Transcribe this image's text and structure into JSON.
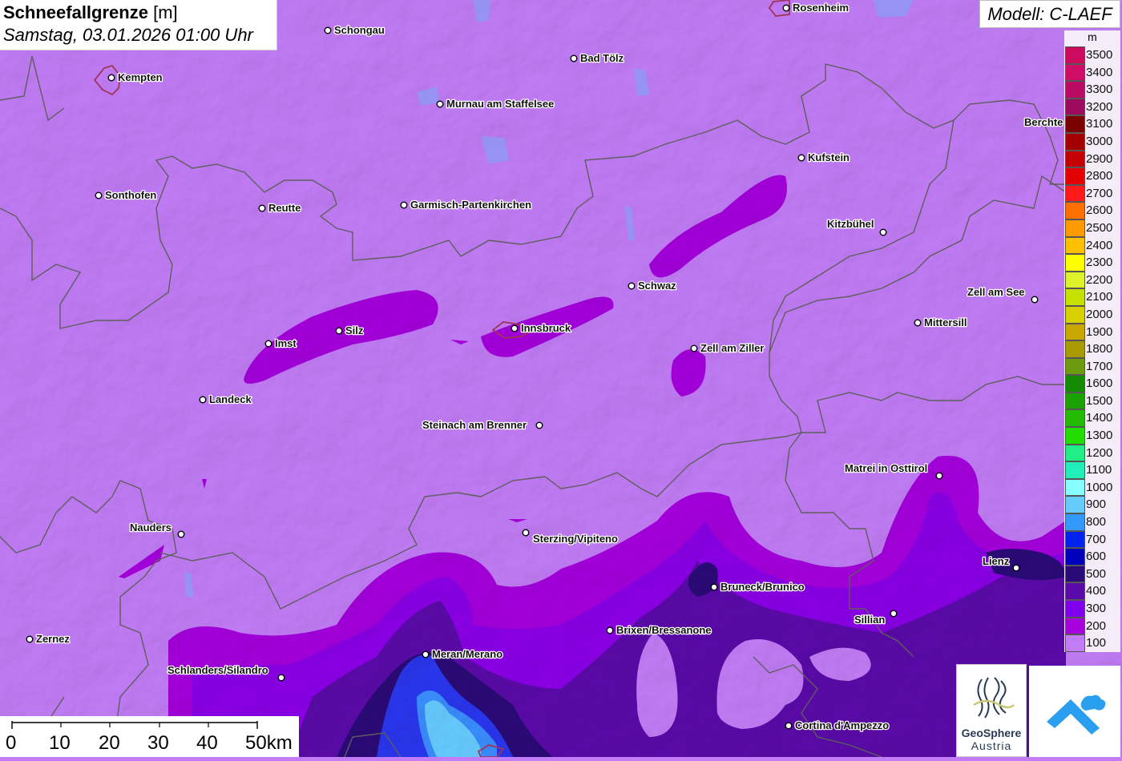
{
  "title": {
    "bold": "Schneefallgrenze",
    "unit": "[m]",
    "date": "Samstag, 03.01.2026 01:00 Uhr"
  },
  "model": "Modell: C-LAEF",
  "legend": {
    "unit": "m",
    "entries": [
      {
        "label": "3500",
        "color": "#cc0a5e"
      },
      {
        "label": "3400",
        "color": "#cf0d66"
      },
      {
        "label": "3300",
        "color": "#bb0a63"
      },
      {
        "label": "3200",
        "color": "#9b0a5c"
      },
      {
        "label": "3100",
        "color": "#7a0000"
      },
      {
        "label": "3000",
        "color": "#a50000"
      },
      {
        "label": "2900",
        "color": "#c50000"
      },
      {
        "label": "2800",
        "color": "#e30000"
      },
      {
        "label": "2700",
        "color": "#ff1a1a"
      },
      {
        "label": "2600",
        "color": "#ff6e00"
      },
      {
        "label": "2500",
        "color": "#ff9a00"
      },
      {
        "label": "2400",
        "color": "#ffc000"
      },
      {
        "label": "2300",
        "color": "#ffff00"
      },
      {
        "label": "2200",
        "color": "#ddf22a"
      },
      {
        "label": "2100",
        "color": "#c6e000"
      },
      {
        "label": "2000",
        "color": "#d9d000"
      },
      {
        "label": "1900",
        "color": "#c8a800"
      },
      {
        "label": "1800",
        "color": "#a89a00"
      },
      {
        "label": "1700",
        "color": "#6e9a10"
      },
      {
        "label": "1600",
        "color": "#148a00"
      },
      {
        "label": "1500",
        "color": "#1aa000"
      },
      {
        "label": "1400",
        "color": "#22bb00"
      },
      {
        "label": "1300",
        "color": "#22dd00"
      },
      {
        "label": "1200",
        "color": "#22ee88"
      },
      {
        "label": "1100",
        "color": "#22eebb"
      },
      {
        "label": "1000",
        "color": "#88ffff"
      },
      {
        "label": "900",
        "color": "#66ccff"
      },
      {
        "label": "800",
        "color": "#3399ff"
      },
      {
        "label": "700",
        "color": "#0022ee"
      },
      {
        "label": "600",
        "color": "#0000bb"
      },
      {
        "label": "500",
        "color": "#2a0a77"
      },
      {
        "label": "400",
        "color": "#5a0aa8"
      },
      {
        "label": "300",
        "color": "#8000ee"
      },
      {
        "label": "200",
        "color": "#a600dd"
      },
      {
        "label": "100",
        "color": "#c27cf6"
      }
    ]
  },
  "cities": [
    {
      "name": "Rosenheim"
    },
    {
      "name": "Schongau"
    },
    {
      "name": "Bad Tölz"
    },
    {
      "name": "Kempten"
    },
    {
      "name": "Murnau am Staffelsee"
    },
    {
      "name": "Berchte"
    },
    {
      "name": "Kufstein"
    },
    {
      "name": "Sonthofen"
    },
    {
      "name": "Reutte"
    },
    {
      "name": "Garmisch-Partenkirchen"
    },
    {
      "name": "Kitzbühel"
    },
    {
      "name": "Schwaz"
    },
    {
      "name": "Zell am See"
    },
    {
      "name": "Mittersill"
    },
    {
      "name": "Imst"
    },
    {
      "name": "Silz"
    },
    {
      "name": "Innsbruck"
    },
    {
      "name": "Zell am Ziller"
    },
    {
      "name": "Landeck"
    },
    {
      "name": "Steinach am Brenner"
    },
    {
      "name": "Matrei in Osttirol"
    },
    {
      "name": "Nauders"
    },
    {
      "name": "Sterzing/Vipiteno"
    },
    {
      "name": "Lienz"
    },
    {
      "name": "Bruneck/Brunico"
    },
    {
      "name": "Sillian"
    },
    {
      "name": "Brixen/Bressanone"
    },
    {
      "name": "Zernez"
    },
    {
      "name": "Schlanders/Silandro"
    },
    {
      "name": "Meran/Merano"
    },
    {
      "name": "Cortina d'Ampezzo"
    }
  ],
  "scale": {
    "labels": [
      "0",
      "10",
      "20",
      "30",
      "40",
      "50km"
    ]
  },
  "logo": {
    "name": "GeoSphere",
    "sub": "Austria"
  }
}
